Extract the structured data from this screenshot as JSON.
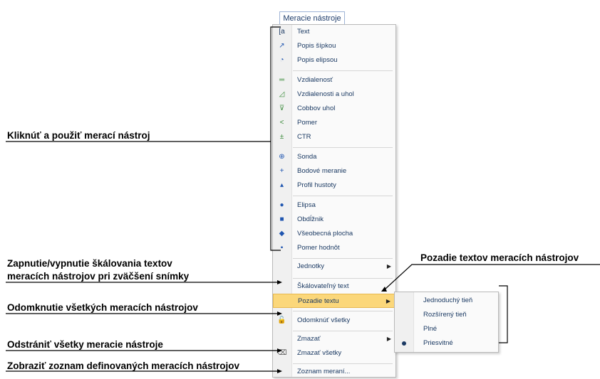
{
  "menu": {
    "title": "Meracie nástroje",
    "items": [
      {
        "label": "Text",
        "icon": "text-tool-icon",
        "glyph": "[a"
      },
      {
        "label": "Popis šípkou",
        "icon": "arrow-caption-icon",
        "glyph": "↗"
      },
      {
        "label": "Popis elipsou",
        "icon": "ellipse-caption-icon",
        "glyph": "◔"
      },
      {
        "label": "Vzdialenosť",
        "icon": "distance-icon",
        "glyph": "═"
      },
      {
        "label": "Vzdialenosti a uhol",
        "icon": "distance-angle-icon",
        "glyph": "◿"
      },
      {
        "label": "Cobbov uhol",
        "icon": "cobb-angle-icon",
        "glyph": "⊽"
      },
      {
        "label": "Pomer",
        "icon": "ratio-icon",
        "glyph": "<"
      },
      {
        "label": "CTR",
        "icon": "ctr-icon",
        "glyph": "±"
      },
      {
        "label": "Sonda",
        "icon": "probe-icon",
        "glyph": "⊕"
      },
      {
        "label": "Bodové meranie",
        "icon": "point-measure-icon",
        "glyph": "+"
      },
      {
        "label": "Profil hustoty",
        "icon": "density-profile-icon",
        "glyph": "▴"
      },
      {
        "label": "Elipsa",
        "icon": "ellipse-icon",
        "glyph": "●"
      },
      {
        "label": "Obdĺžnik",
        "icon": "rectangle-icon",
        "glyph": "■"
      },
      {
        "label": "Všeobecná plocha",
        "icon": "general-area-icon",
        "glyph": "◆"
      },
      {
        "label": "Pomer hodnôt",
        "icon": "value-ratio-icon",
        "glyph": "▪"
      }
    ],
    "units": "Jednotky",
    "scalable": "Škálovateľný text",
    "background": "Pozadie textu",
    "unlock_all": "Odomknúť všetky",
    "delete": "Zmazať",
    "delete_all": "Zmazať všetky",
    "list": "Zoznam meraní..."
  },
  "submenu": [
    "Jednoduchý tieň",
    "Rozšírený tieň",
    "Plné",
    "Priesvitné"
  ],
  "annotations": {
    "click_use": "Kliknúť a použiť merací nástroj",
    "toggle_scale_1": "Zapnutie/vypnutie škálovania textov",
    "toggle_scale_2": "meracích nástrojov pri zväčšení snímky",
    "unlock": "Odomknutie všetkých meracích nástrojov",
    "delete_all": "Odstrániť všetky meracie nástroje",
    "show_list": "Zobraziť zoznam definovaných meracích nástrojov",
    "bg": "Pozadie textov meracích nástrojov"
  },
  "colors": {
    "highlight": "#fbd77a",
    "menu_text": "#1b3a63"
  }
}
